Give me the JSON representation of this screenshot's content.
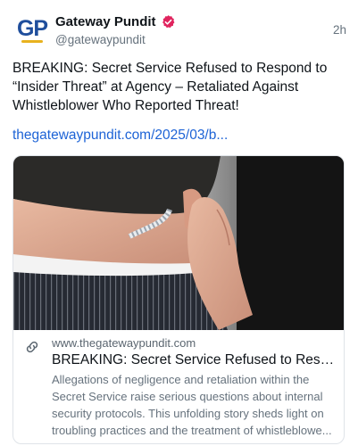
{
  "author": {
    "avatar_text": "GP",
    "display_name": "Gateway Pundit",
    "handle": "@gatewaypundit",
    "verified_icon": "verified-badge-icon",
    "verified_color": "#e0245e"
  },
  "post": {
    "timestamp": "2h",
    "text": "BREAKING: Secret Service Refused to Respond to “Insider Threat” at Agency – Retaliated Against Whistleblower Who Reported Threat!",
    "link_text": "thegatewaypundit.com/2025/03/b..."
  },
  "card": {
    "image_subject": "agent-with-earpiece-photo",
    "link_icon": "link-icon",
    "domain": "www.thegatewaypundit.com",
    "title": "BREAKING: Secret Service Refused to Respon...",
    "description": "Allegations of negligence and retaliation within the Secret Service raise serious questions about internal security protocols. This unfolding story sheds light on troubling practices and the treatment of whistleblowe..."
  },
  "colors": {
    "link": "#1d63d6",
    "secondary_text": "#66727d",
    "border": "#dfe3e8"
  }
}
